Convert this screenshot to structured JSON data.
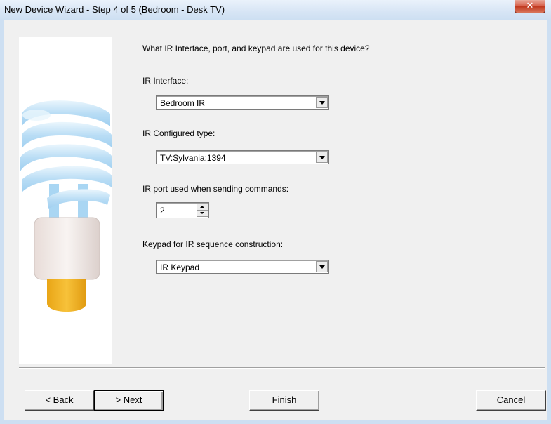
{
  "window": {
    "title": "New Device Wizard - Step 4 of 5 (Bedroom - Desk TV)",
    "close_glyph": "✕"
  },
  "wizard": {
    "question": "What IR Interface, port, and keypad are used for this device?",
    "ir_interface": {
      "label": "IR Interface:",
      "value": "Bedroom IR"
    },
    "ir_configured_type": {
      "label": "IR Configured type:",
      "value": "TV:Sylvania:1394"
    },
    "ir_port": {
      "label": "IR port used when sending commands:",
      "value": "2"
    },
    "keypad": {
      "label": "Keypad for IR sequence construction:",
      "value": "IR Keypad"
    }
  },
  "buttons": {
    "back": {
      "prefix": "< ",
      "mnemonic": "B",
      "rest": "ack"
    },
    "next": {
      "prefix": "> ",
      "mnemonic": "N",
      "rest": "ext"
    },
    "finish": "Finish",
    "cancel": "Cancel"
  },
  "colors": {
    "bulb_coil": "#b9ddf5",
    "bulb_base": "#f1e8e4",
    "bulb_cap": "#f0b323"
  },
  "icons": {
    "wizard_art": "cfl-bulb-icon",
    "dropdown": "chevron-down-icon",
    "close": "close-icon"
  }
}
